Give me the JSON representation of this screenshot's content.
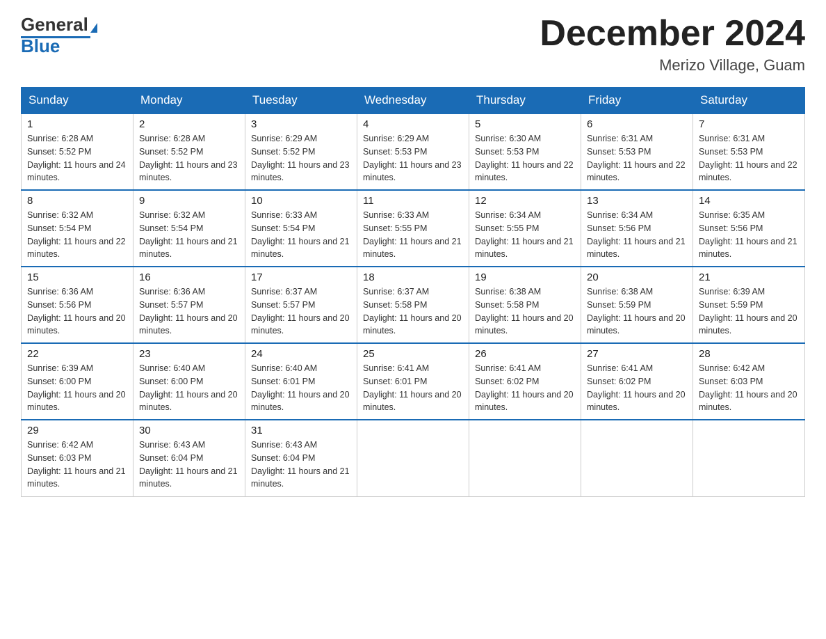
{
  "header": {
    "logo_general": "General",
    "logo_blue": "Blue",
    "month_title": "December 2024",
    "location": "Merizo Village, Guam"
  },
  "weekdays": [
    "Sunday",
    "Monday",
    "Tuesday",
    "Wednesday",
    "Thursday",
    "Friday",
    "Saturday"
  ],
  "weeks": [
    [
      {
        "day": "1",
        "sunrise": "6:28 AM",
        "sunset": "5:52 PM",
        "daylight": "11 hours and 24 minutes."
      },
      {
        "day": "2",
        "sunrise": "6:28 AM",
        "sunset": "5:52 PM",
        "daylight": "11 hours and 23 minutes."
      },
      {
        "day": "3",
        "sunrise": "6:29 AM",
        "sunset": "5:52 PM",
        "daylight": "11 hours and 23 minutes."
      },
      {
        "day": "4",
        "sunrise": "6:29 AM",
        "sunset": "5:53 PM",
        "daylight": "11 hours and 23 minutes."
      },
      {
        "day": "5",
        "sunrise": "6:30 AM",
        "sunset": "5:53 PM",
        "daylight": "11 hours and 22 minutes."
      },
      {
        "day": "6",
        "sunrise": "6:31 AM",
        "sunset": "5:53 PM",
        "daylight": "11 hours and 22 minutes."
      },
      {
        "day": "7",
        "sunrise": "6:31 AM",
        "sunset": "5:53 PM",
        "daylight": "11 hours and 22 minutes."
      }
    ],
    [
      {
        "day": "8",
        "sunrise": "6:32 AM",
        "sunset": "5:54 PM",
        "daylight": "11 hours and 22 minutes."
      },
      {
        "day": "9",
        "sunrise": "6:32 AM",
        "sunset": "5:54 PM",
        "daylight": "11 hours and 21 minutes."
      },
      {
        "day": "10",
        "sunrise": "6:33 AM",
        "sunset": "5:54 PM",
        "daylight": "11 hours and 21 minutes."
      },
      {
        "day": "11",
        "sunrise": "6:33 AM",
        "sunset": "5:55 PM",
        "daylight": "11 hours and 21 minutes."
      },
      {
        "day": "12",
        "sunrise": "6:34 AM",
        "sunset": "5:55 PM",
        "daylight": "11 hours and 21 minutes."
      },
      {
        "day": "13",
        "sunrise": "6:34 AM",
        "sunset": "5:56 PM",
        "daylight": "11 hours and 21 minutes."
      },
      {
        "day": "14",
        "sunrise": "6:35 AM",
        "sunset": "5:56 PM",
        "daylight": "11 hours and 21 minutes."
      }
    ],
    [
      {
        "day": "15",
        "sunrise": "6:36 AM",
        "sunset": "5:56 PM",
        "daylight": "11 hours and 20 minutes."
      },
      {
        "day": "16",
        "sunrise": "6:36 AM",
        "sunset": "5:57 PM",
        "daylight": "11 hours and 20 minutes."
      },
      {
        "day": "17",
        "sunrise": "6:37 AM",
        "sunset": "5:57 PM",
        "daylight": "11 hours and 20 minutes."
      },
      {
        "day": "18",
        "sunrise": "6:37 AM",
        "sunset": "5:58 PM",
        "daylight": "11 hours and 20 minutes."
      },
      {
        "day": "19",
        "sunrise": "6:38 AM",
        "sunset": "5:58 PM",
        "daylight": "11 hours and 20 minutes."
      },
      {
        "day": "20",
        "sunrise": "6:38 AM",
        "sunset": "5:59 PM",
        "daylight": "11 hours and 20 minutes."
      },
      {
        "day": "21",
        "sunrise": "6:39 AM",
        "sunset": "5:59 PM",
        "daylight": "11 hours and 20 minutes."
      }
    ],
    [
      {
        "day": "22",
        "sunrise": "6:39 AM",
        "sunset": "6:00 PM",
        "daylight": "11 hours and 20 minutes."
      },
      {
        "day": "23",
        "sunrise": "6:40 AM",
        "sunset": "6:00 PM",
        "daylight": "11 hours and 20 minutes."
      },
      {
        "day": "24",
        "sunrise": "6:40 AM",
        "sunset": "6:01 PM",
        "daylight": "11 hours and 20 minutes."
      },
      {
        "day": "25",
        "sunrise": "6:41 AM",
        "sunset": "6:01 PM",
        "daylight": "11 hours and 20 minutes."
      },
      {
        "day": "26",
        "sunrise": "6:41 AM",
        "sunset": "6:02 PM",
        "daylight": "11 hours and 20 minutes."
      },
      {
        "day": "27",
        "sunrise": "6:41 AM",
        "sunset": "6:02 PM",
        "daylight": "11 hours and 20 minutes."
      },
      {
        "day": "28",
        "sunrise": "6:42 AM",
        "sunset": "6:03 PM",
        "daylight": "11 hours and 20 minutes."
      }
    ],
    [
      {
        "day": "29",
        "sunrise": "6:42 AM",
        "sunset": "6:03 PM",
        "daylight": "11 hours and 21 minutes."
      },
      {
        "day": "30",
        "sunrise": "6:43 AM",
        "sunset": "6:04 PM",
        "daylight": "11 hours and 21 minutes."
      },
      {
        "day": "31",
        "sunrise": "6:43 AM",
        "sunset": "6:04 PM",
        "daylight": "11 hours and 21 minutes."
      },
      null,
      null,
      null,
      null
    ]
  ]
}
